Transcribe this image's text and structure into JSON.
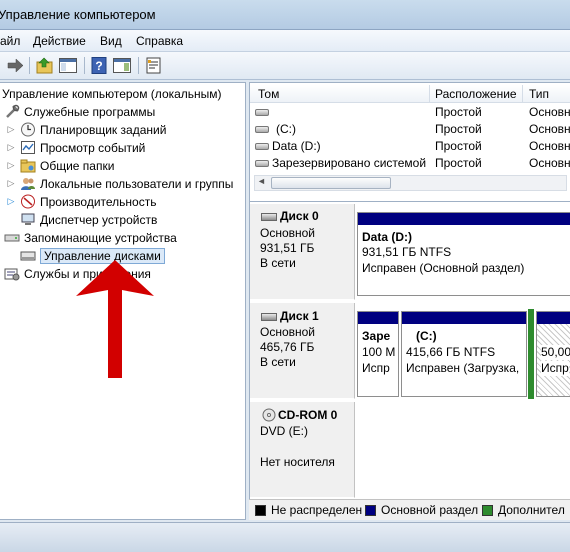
{
  "window": {
    "title": "Управление компьютером"
  },
  "menu": {
    "file": "айл",
    "action": "Действие",
    "view": "Вид",
    "help": "Справка"
  },
  "tree": {
    "root": "Управление компьютером (локальным)",
    "utilities": "Служебные программы",
    "task_scheduler": "Планировщик заданий",
    "event_viewer": "Просмотр событий",
    "shared_folders": "Общие папки",
    "local_users": "Локальные пользователи и группы",
    "performance": "Производительность",
    "device_manager": "Диспетчер устройств",
    "storage": "Запоминающие устройства",
    "disk_management": "Управление дисками",
    "services": "Службы и приложения"
  },
  "volumes": {
    "headers": {
      "volume": "Том",
      "layout": "Расположение",
      "type": "Тип"
    },
    "rows": [
      {
        "name": "",
        "layout": "Простой",
        "type": "Основн"
      },
      {
        "name": "(C:)",
        "layout": "Простой",
        "type": "Основн"
      },
      {
        "name": "Data (D:)",
        "layout": "Простой",
        "type": "Основн"
      },
      {
        "name": "Зарезервировано системой",
        "layout": "Простой",
        "type": "Основн"
      }
    ]
  },
  "disks": {
    "disk0": {
      "name": "Диск 0",
      "kind": "Основной",
      "size": "931,51 ГБ",
      "status": "В сети",
      "partition": {
        "name": "Data  (D:)",
        "size": "931,51 ГБ NTFS",
        "status": "Исправен (Основной раздел)"
      }
    },
    "disk1": {
      "name": "Диск 1",
      "kind": "Основной",
      "size": "465,76 ГБ",
      "status": "В сети",
      "p1": {
        "name": "Заре",
        "size": "100 М",
        "status": "Испр"
      },
      "p2": {
        "name": "(C:)",
        "size": "415,66 ГБ NTFS",
        "status": "Исправен (Загрузка,"
      },
      "p3": {
        "size": "50,00",
        "status": "Испр"
      }
    },
    "cdrom": {
      "name": "CD-ROM 0",
      "drive": "DVD (E:)",
      "status": "Нет носителя"
    }
  },
  "legend": {
    "unallocated": "Не распределен",
    "primary": "Основной раздел",
    "extended": "Дополнител",
    "colors": {
      "unallocated": "#000000",
      "primary": "#000080",
      "extended": "#2e8b2e"
    }
  },
  "colors": {
    "accent_arrow": "#d20000",
    "selection": "#dbe9f8"
  }
}
